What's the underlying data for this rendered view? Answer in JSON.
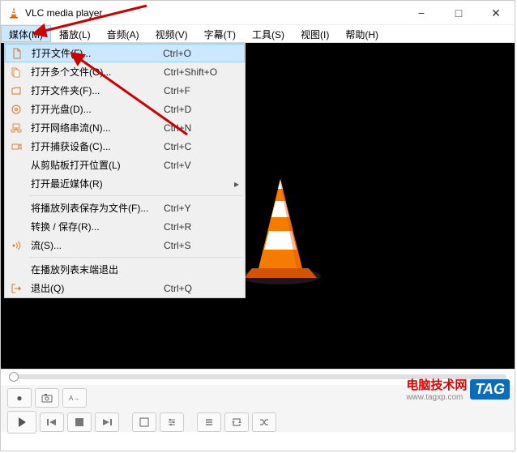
{
  "titlebar": {
    "title": "VLC media player"
  },
  "window_controls": {
    "min": "−",
    "max": "□",
    "close": "✕"
  },
  "menubar": [
    {
      "label": "媒体(M)",
      "active": true
    },
    {
      "label": "播放(L)"
    },
    {
      "label": "音频(A)"
    },
    {
      "label": "视频(V)"
    },
    {
      "label": "字幕(T)"
    },
    {
      "label": "工具(S)"
    },
    {
      "label": "视图(I)"
    },
    {
      "label": "帮助(H)"
    }
  ],
  "dropdown": [
    {
      "icon": "file",
      "label": "打开文件(F)...",
      "shortcut": "Ctrl+O",
      "highlighted": true
    },
    {
      "icon": "files",
      "label": "打开多个文件(O)...",
      "shortcut": "Ctrl+Shift+O"
    },
    {
      "icon": "folder",
      "label": "打开文件夹(F)...",
      "shortcut": "Ctrl+F"
    },
    {
      "icon": "disc",
      "label": "打开光盘(D)...",
      "shortcut": "Ctrl+D"
    },
    {
      "icon": "network",
      "label": "打开网络串流(N)...",
      "shortcut": "Ctrl+N"
    },
    {
      "icon": "capture",
      "label": "打开捕获设备(C)...",
      "shortcut": "Ctrl+C"
    },
    {
      "icon": "",
      "label": "从剪贴板打开位置(L)",
      "shortcut": "Ctrl+V"
    },
    {
      "icon": "",
      "label": "打开最近媒体(R)",
      "shortcut": "",
      "submenu": true
    },
    {
      "sep": true
    },
    {
      "icon": "",
      "label": "将播放列表保存为文件(F)...",
      "shortcut": "Ctrl+Y"
    },
    {
      "icon": "",
      "label": "转换 / 保存(R)...",
      "shortcut": "Ctrl+R"
    },
    {
      "icon": "stream",
      "label": "流(S)...",
      "shortcut": "Ctrl+S"
    },
    {
      "sep": true
    },
    {
      "icon": "",
      "label": "在播放列表末端退出",
      "shortcut": ""
    },
    {
      "icon": "exit",
      "label": "退出(Q)",
      "shortcut": "Ctrl+Q"
    }
  ],
  "watermark": {
    "line1": "电脑技术网",
    "line2": "www.tagxp.com",
    "tag": "TAG"
  }
}
